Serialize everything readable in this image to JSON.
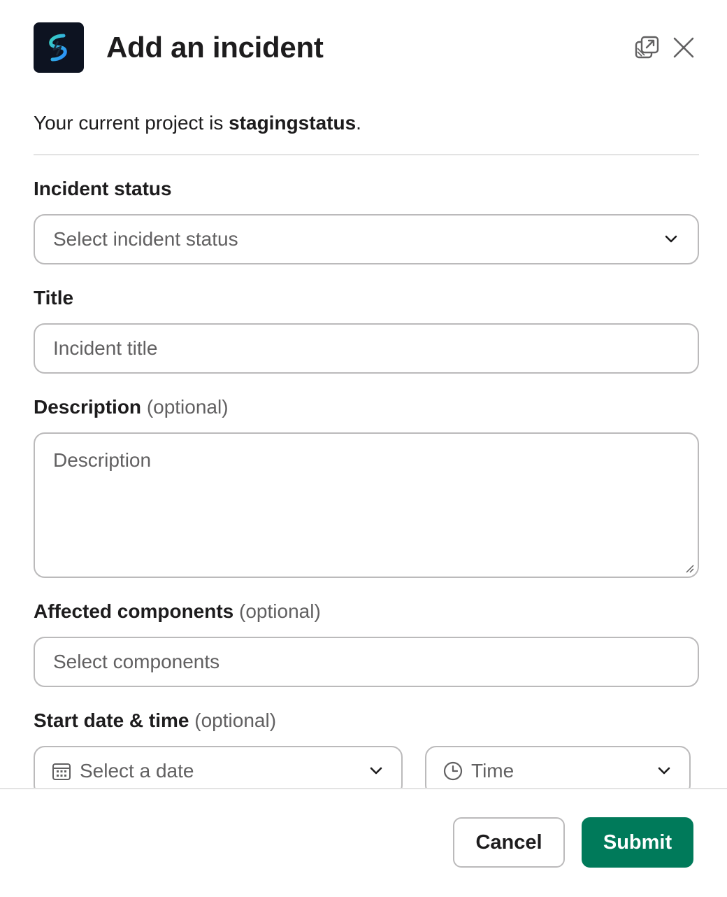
{
  "modal": {
    "title": "Add an incident",
    "accent_color": "#007a5a",
    "app_icon": "statuspage-bolt-icon"
  },
  "header": {
    "popout_icon": "popout-icon",
    "close_icon": "close-icon"
  },
  "project": {
    "prefix": "Your current project is ",
    "name": "stagingstatus",
    "suffix": "."
  },
  "form": {
    "incident_status": {
      "label": "Incident status",
      "placeholder": "Select incident status"
    },
    "title": {
      "label": "Title",
      "placeholder": "Incident title"
    },
    "description": {
      "label": "Description",
      "optional": "(optional)",
      "placeholder": "Description"
    },
    "affected_components": {
      "label": "Affected components",
      "optional": "(optional)",
      "placeholder": "Select components"
    },
    "start": {
      "label": "Start date & time",
      "optional": "(optional)",
      "date_placeholder": "Select a date",
      "time_placeholder": "Time"
    }
  },
  "footer": {
    "cancel_label": "Cancel",
    "submit_label": "Submit"
  }
}
